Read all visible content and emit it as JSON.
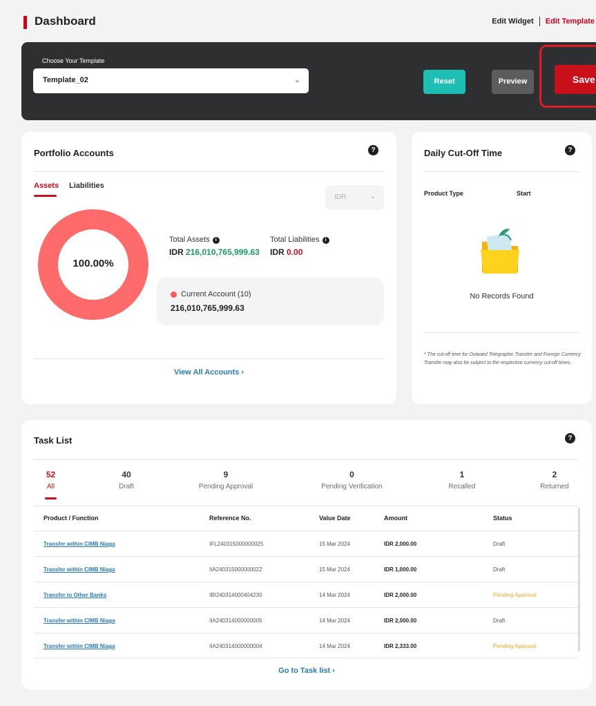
{
  "header": {
    "title": "Dashboard",
    "edit_widget": "Edit Widget",
    "edit_template": "Edit Template"
  },
  "template_bar": {
    "label": "Choose Your Template",
    "selected": "Template_02",
    "reset": "Reset",
    "preview": "Preview",
    "save": "Save"
  },
  "portfolio": {
    "title": "Portfolio Accounts",
    "help": "?",
    "tabs": [
      "Assets",
      "Liabilities"
    ],
    "currency": "IDR",
    "percent": "100.00%",
    "total_assets_label": "Total Assets",
    "total_assets_currency": "IDR",
    "total_assets_value": "216,010,765,999.63",
    "total_liabilities_label": "Total Liabilities",
    "total_liabilities_currency": "IDR",
    "total_liabilities_value": "0.00",
    "account_name": "Current Account (10)",
    "account_value": "216,010,765,999.63",
    "view_all": "View All Accounts ›",
    "donut_color": "#ff6b6b"
  },
  "cutoff": {
    "title": "Daily Cut-Off Time",
    "help": "?",
    "col_product": "Product Type",
    "col_start": "Start",
    "empty": "No Records Found",
    "note": "* The cut-off time for Outward Telegraphic Transfer and Foreign Currency Transfer may also be subject to the respective currency cut-off times."
  },
  "task": {
    "title": "Task List",
    "help": "?",
    "stats": [
      {
        "num": "52",
        "label": "All"
      },
      {
        "num": "40",
        "label": "Draft"
      },
      {
        "num": "9",
        "label": "Pending Approval"
      },
      {
        "num": "0",
        "label": "Pending Verification"
      },
      {
        "num": "1",
        "label": "Recalled"
      },
      {
        "num": "2",
        "label": "Returned"
      }
    ],
    "columns": [
      "Product / Function",
      "Reference No.",
      "Value Date",
      "Amount",
      "Status"
    ],
    "rows": [
      {
        "product": "Transfer within CIMB Niaga",
        "ref": "IFL240315000000025",
        "date": "15 Mar 2024",
        "amount": "IDR 2,000.00",
        "status": "Draft"
      },
      {
        "product": "Transfer within CIMB Niaga",
        "ref": "IIA240315000000022",
        "date": "15 Mar 2024",
        "amount": "IDR 1,000.00",
        "status": "Draft"
      },
      {
        "product": "Transfer to Other Banks",
        "ref": "IBI240314000404230",
        "date": "14 Mar 2024",
        "amount": "IDR 2,000.00",
        "status": "Pending Approval"
      },
      {
        "product": "Transfer within CIMB Niaga",
        "ref": "IIA240314000000005",
        "date": "14 Mar 2024",
        "amount": "IDR 2,000.00",
        "status": "Draft"
      },
      {
        "product": "Transfer within CIMB Niaga",
        "ref": "IIA240314000000004",
        "date": "14 Mar 2024",
        "amount": "IDR 2,333.00",
        "status": "Pending Approval"
      }
    ],
    "goto": "Go to Task list ›",
    "pending_color": "#f5a623"
  }
}
